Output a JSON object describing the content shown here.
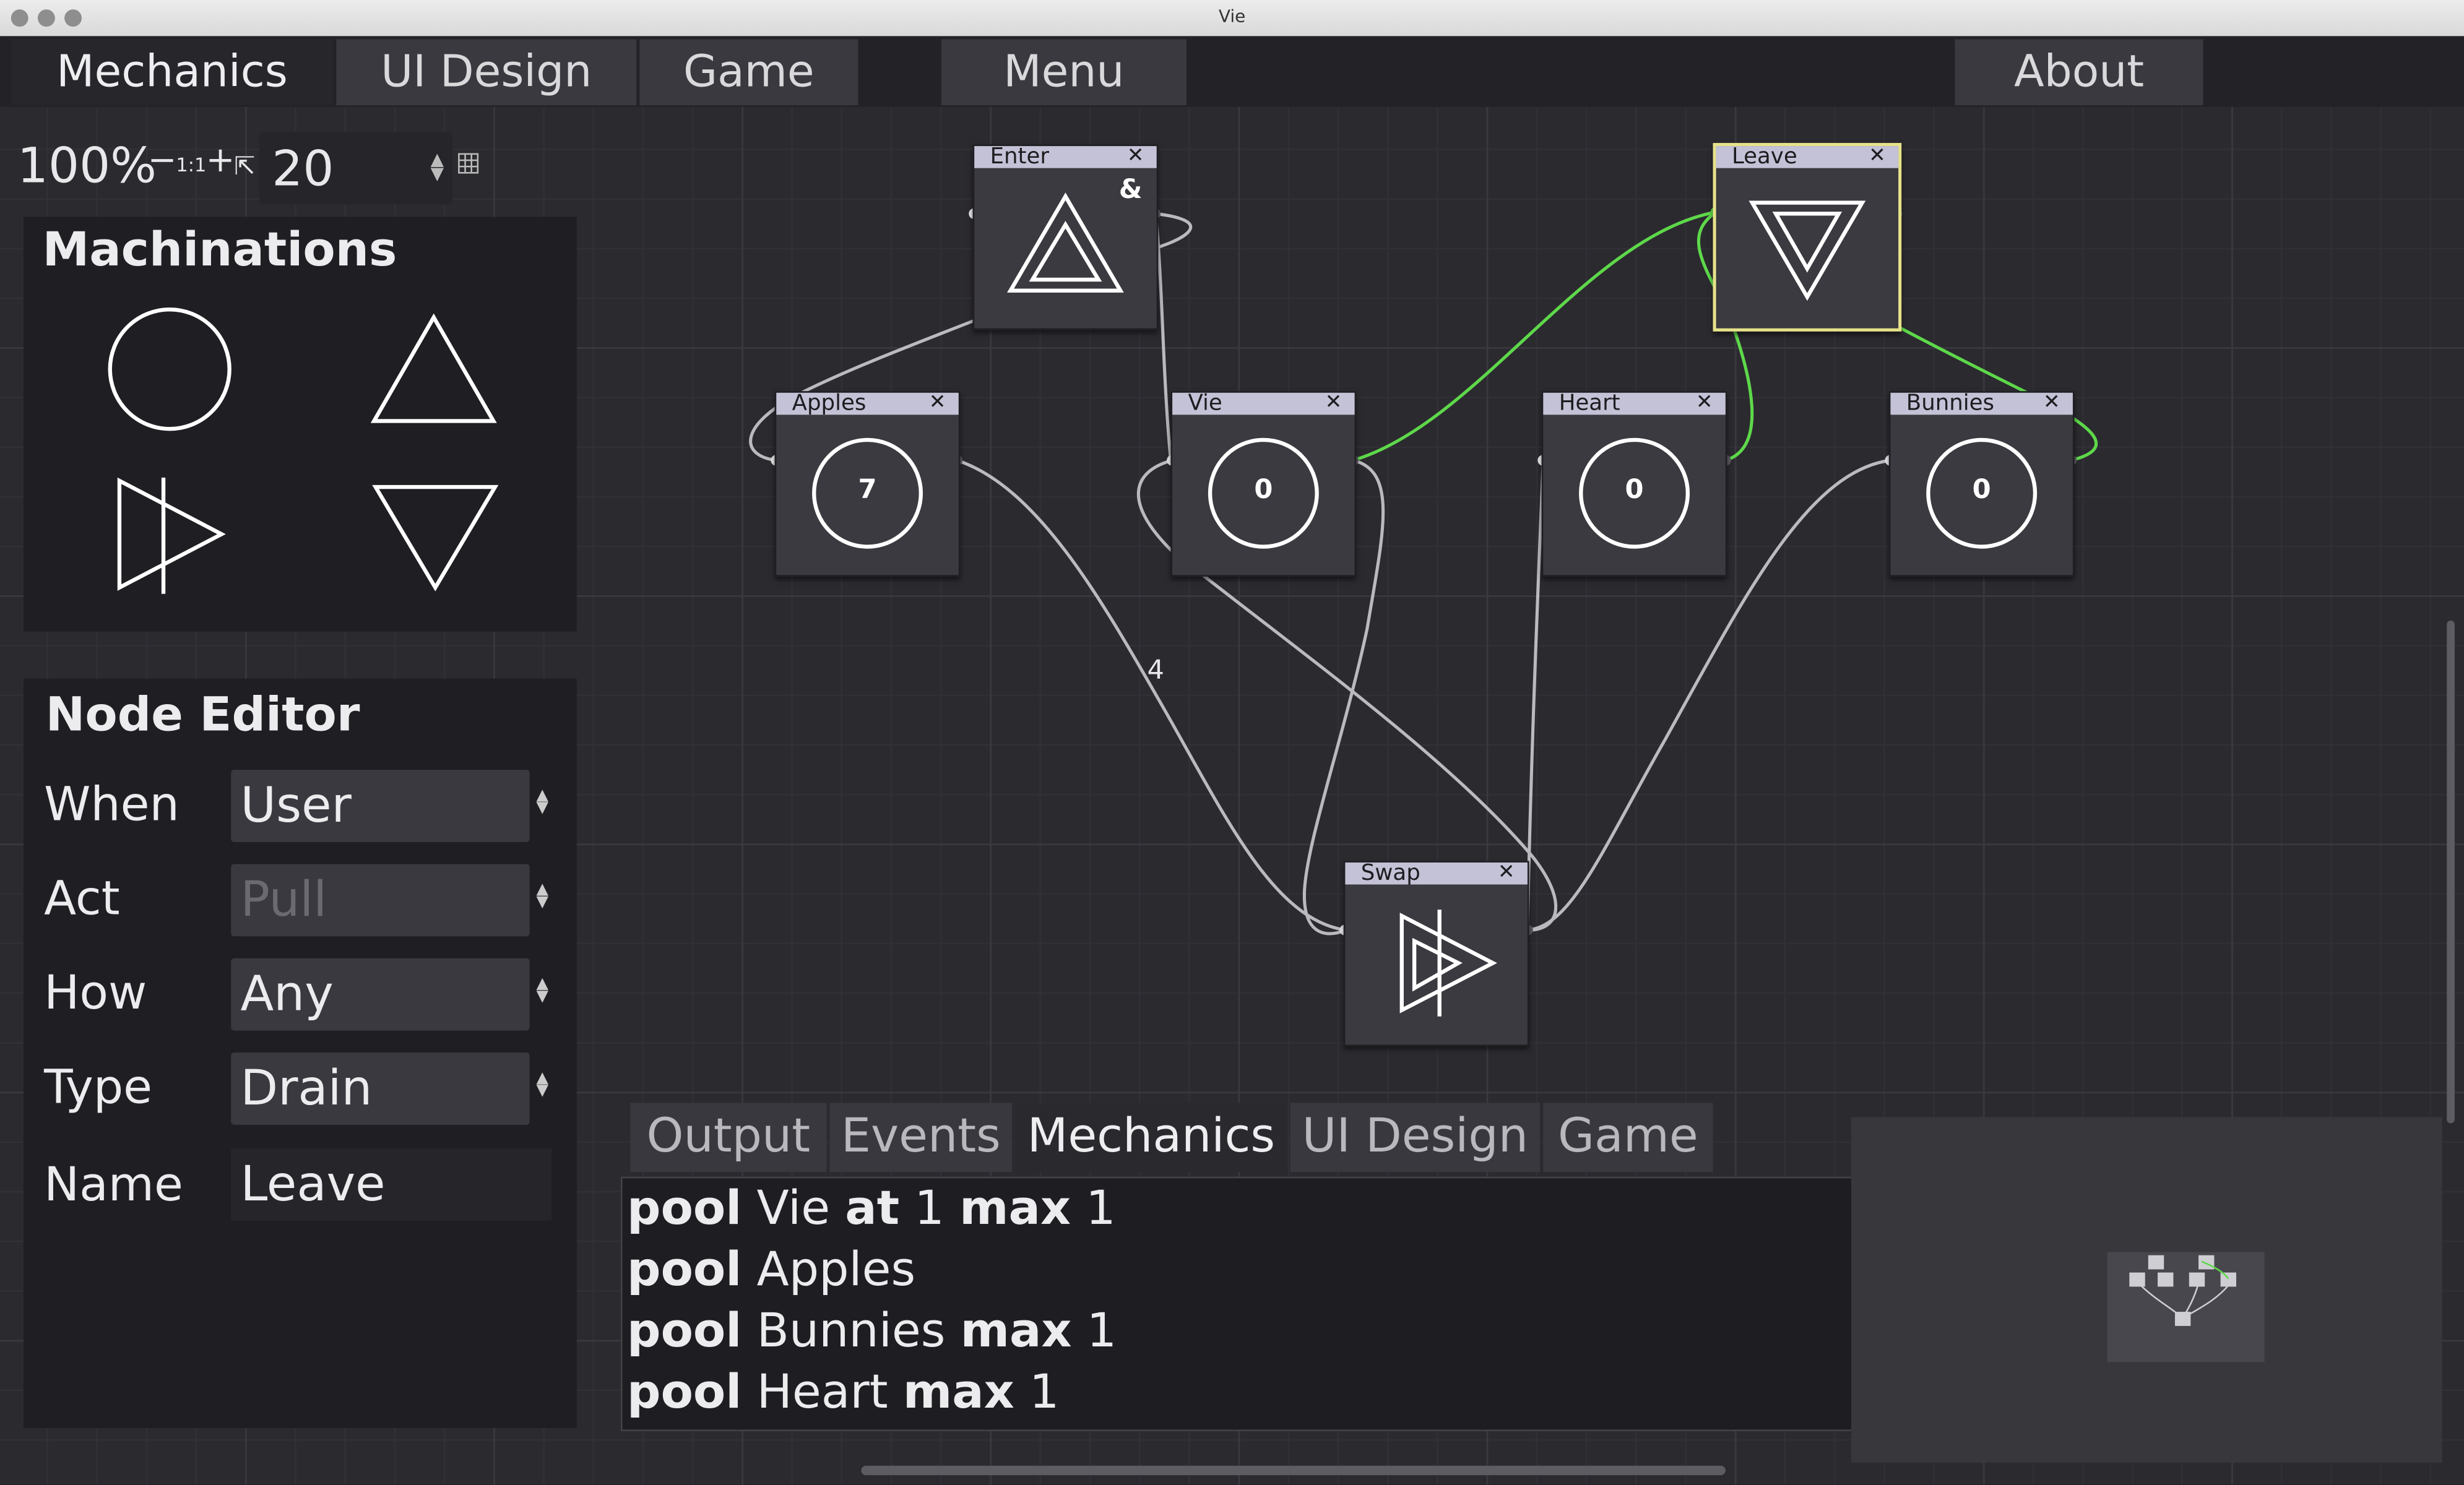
{
  "window": {
    "title": "Vie"
  },
  "top_tabs": [
    "Mechanics",
    "UI Design",
    "Game",
    "Menu",
    "About"
  ],
  "zoom": {
    "percent": "100%",
    "minus": "−",
    "one_to_one": "1:1",
    "plus": "+",
    "fit": "⇱",
    "grid_value": "20"
  },
  "machinations": {
    "title": "Machinations"
  },
  "node_editor": {
    "title": "Node Editor",
    "when_label": "When",
    "when_value": "User",
    "act_label": "Act",
    "act_value": "Pull",
    "how_label": "How",
    "how_value": "Any",
    "type_label": "Type",
    "type_value": "Drain",
    "name_label": "Name",
    "name_value": "Leave"
  },
  "nodes": {
    "enter": {
      "name": "Enter",
      "badge": "&"
    },
    "leave": {
      "name": "Leave"
    },
    "apples": {
      "name": "Apples",
      "value": "7"
    },
    "vie": {
      "name": "Vie",
      "value": "0"
    },
    "heart": {
      "name": "Heart",
      "value": "0"
    },
    "bunnies": {
      "name": "Bunnies",
      "value": "0"
    },
    "swap": {
      "name": "Swap"
    },
    "close": "✕"
  },
  "edge_label": "4",
  "bottom_tabs": [
    "Output",
    "Events",
    "Mechanics",
    "UI Design",
    "Game"
  ],
  "output_lines": [
    {
      "kw": "pool",
      "name": "Vie",
      "kw2": "at",
      "v2": "1",
      "kw3": "max",
      "v3": "1"
    },
    {
      "kw": "pool",
      "name": "Apples"
    },
    {
      "kw": "pool",
      "name": "Bunnies",
      "kw3": "max",
      "v3": "1"
    },
    {
      "kw": "pool",
      "name": "Heart",
      "kw3": "max",
      "v3": "1"
    }
  ],
  "colors": {
    "accent_green": "#5ed84a",
    "selected_border": "#e6e28a",
    "edge": "#d4d4d8"
  }
}
